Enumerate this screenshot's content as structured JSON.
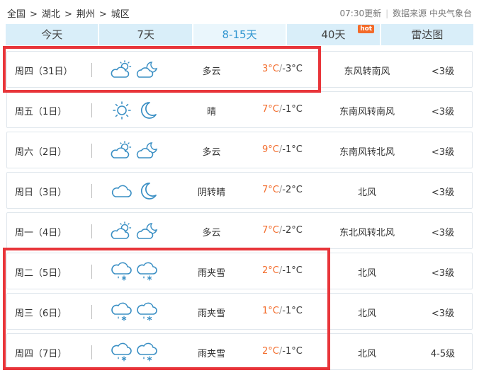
{
  "breadcrumb": {
    "items": [
      "全国",
      "湖北",
      "荆州",
      "城区"
    ],
    "separator": ">"
  },
  "meta": {
    "update": "07:30更新",
    "source": "数据来源 中央气象台"
  },
  "tabs": [
    {
      "label": "今天",
      "active": false
    },
    {
      "label": "7天",
      "active": false
    },
    {
      "label": "8-15天",
      "active": true
    },
    {
      "label": "40天",
      "active": false,
      "badge": "hot"
    },
    {
      "label": "雷达图",
      "active": false
    }
  ],
  "forecast": [
    {
      "day": "周四（31日）",
      "day_icon": "partly-cloudy-sun-icon",
      "night_icon": "partly-cloudy-moon-icon",
      "cond": "多云",
      "hi": "3°C",
      "lo": "-3°C",
      "wind": "东风转南风",
      "level": "<3级"
    },
    {
      "day": "周五（1日）",
      "day_icon": "sun-icon",
      "night_icon": "moon-icon",
      "cond": "晴",
      "hi": "7°C",
      "lo": "-1°C",
      "wind": "东南风转南风",
      "level": "<3级"
    },
    {
      "day": "周六（2日）",
      "day_icon": "partly-cloudy-sun-icon",
      "night_icon": "partly-cloudy-moon-icon",
      "cond": "多云",
      "hi": "9°C",
      "lo": "-1°C",
      "wind": "东南风转北风",
      "level": "<3级"
    },
    {
      "day": "周日（3日）",
      "day_icon": "cloud-icon",
      "night_icon": "moon-icon",
      "cond": "阴转晴",
      "hi": "7°C",
      "lo": "-2°C",
      "wind": "北风",
      "level": "<3级"
    },
    {
      "day": "周一（4日）",
      "day_icon": "partly-cloudy-sun-icon",
      "night_icon": "partly-cloudy-moon-icon",
      "cond": "多云",
      "hi": "7°C",
      "lo": "-2°C",
      "wind": "东北风转北风",
      "level": "<3级"
    },
    {
      "day": "周二（5日）",
      "day_icon": "sleet-icon",
      "night_icon": "sleet-icon",
      "cond": "雨夹雪",
      "hi": "2°C",
      "lo": "-1°C",
      "wind": "北风",
      "level": "<3级"
    },
    {
      "day": "周三（6日）",
      "day_icon": "sleet-icon",
      "night_icon": "sleet-icon",
      "cond": "雨夹雪",
      "hi": "1°C",
      "lo": "-1°C",
      "wind": "北风",
      "level": "<3级"
    },
    {
      "day": "周四（7日）",
      "day_icon": "sleet-icon",
      "night_icon": "sleet-icon",
      "cond": "雨夹雪",
      "hi": "2°C",
      "lo": "-1°C",
      "wind": "北风",
      "level": "4-5级"
    }
  ],
  "colors": {
    "accent": "#3196d0",
    "hot_temp": "#f36b2a",
    "highlight": "#e8353a",
    "icon": "#3a8fc4"
  }
}
